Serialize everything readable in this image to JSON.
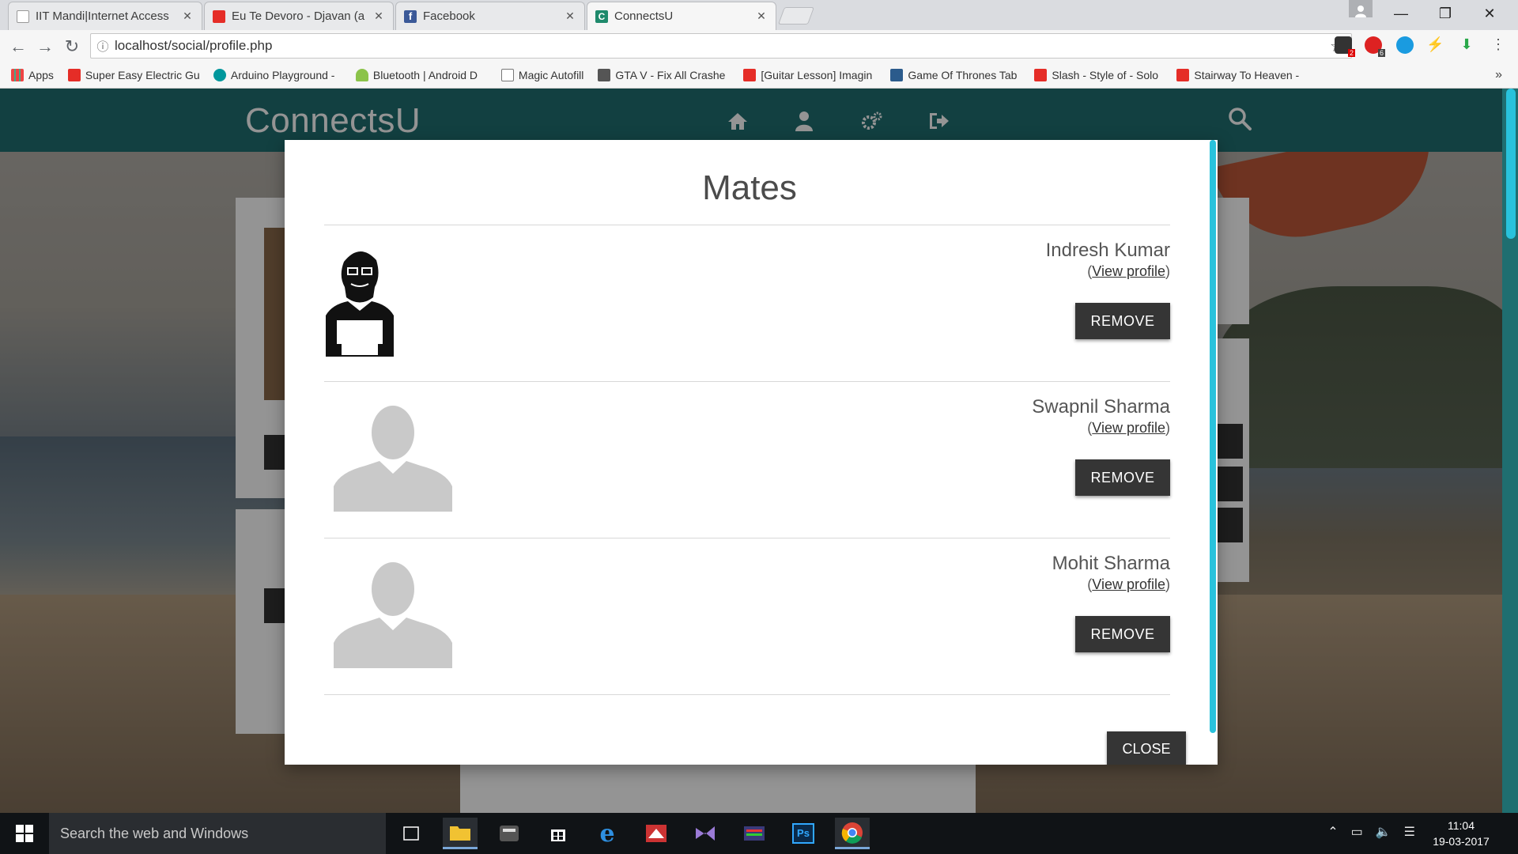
{
  "browser": {
    "tabs": [
      {
        "title": "IIT Mandi|Internet Access",
        "icon": "page-icon",
        "active": false
      },
      {
        "title": "Eu Te Devoro - Djavan (a",
        "icon": "youtube-icon",
        "active": false
      },
      {
        "title": "Facebook",
        "icon": "facebook-icon",
        "active": false
      },
      {
        "title": "ConnectsU",
        "icon": "connectsu-icon",
        "active": true
      }
    ],
    "url": "localhost/social/profile.php",
    "bookmarks": [
      {
        "label": "Apps",
        "icon": "apps-grid-icon"
      },
      {
        "label": "Super Easy Electric Gu",
        "icon": "youtube-icon"
      },
      {
        "label": "Arduino Playground -",
        "icon": "arduino-icon"
      },
      {
        "label": "Bluetooth | Android D",
        "icon": "android-icon"
      },
      {
        "label": "Magic Autofill",
        "icon": "page-icon"
      },
      {
        "label": "GTA V - Fix All Crashe",
        "icon": "gta-icon"
      },
      {
        "label": "[Guitar Lesson] Imagin",
        "icon": "youtube-icon"
      },
      {
        "label": "Game Of Thrones Tab",
        "icon": "site-icon"
      },
      {
        "label": "Slash - Style of - Solo",
        "icon": "youtube-icon"
      },
      {
        "label": "Stairway To Heaven -",
        "icon": "youtube-icon"
      }
    ],
    "bookmarks_more": "»",
    "extension_badges": [
      "2",
      "6"
    ]
  },
  "site": {
    "logo": "ConnectsU",
    "nav": [
      "home-icon",
      "user-icon",
      "settings-icon",
      "logout-icon",
      "search-icon"
    ]
  },
  "modal": {
    "title": "Mates",
    "mates": [
      {
        "name": "Indresh Kumar",
        "view_profile": "View profile",
        "remove_label": "REMOVE",
        "avatar": "custom-avatar"
      },
      {
        "name": "Swapnil Sharma",
        "view_profile": "View profile",
        "remove_label": "REMOVE",
        "avatar": "default-avatar"
      },
      {
        "name": "Mohit Sharma",
        "view_profile": "View profile",
        "remove_label": "REMOVE",
        "avatar": "default-avatar"
      }
    ],
    "paren_open": "(",
    "paren_close": ")",
    "close_label": "CLOSE"
  },
  "taskbar": {
    "search_placeholder": "Search the web and Windows",
    "time": "11:04",
    "date": "19-03-2017"
  },
  "colors": {
    "header": "#1f6e70",
    "accent": "#29c2dc",
    "button": "#353535"
  }
}
